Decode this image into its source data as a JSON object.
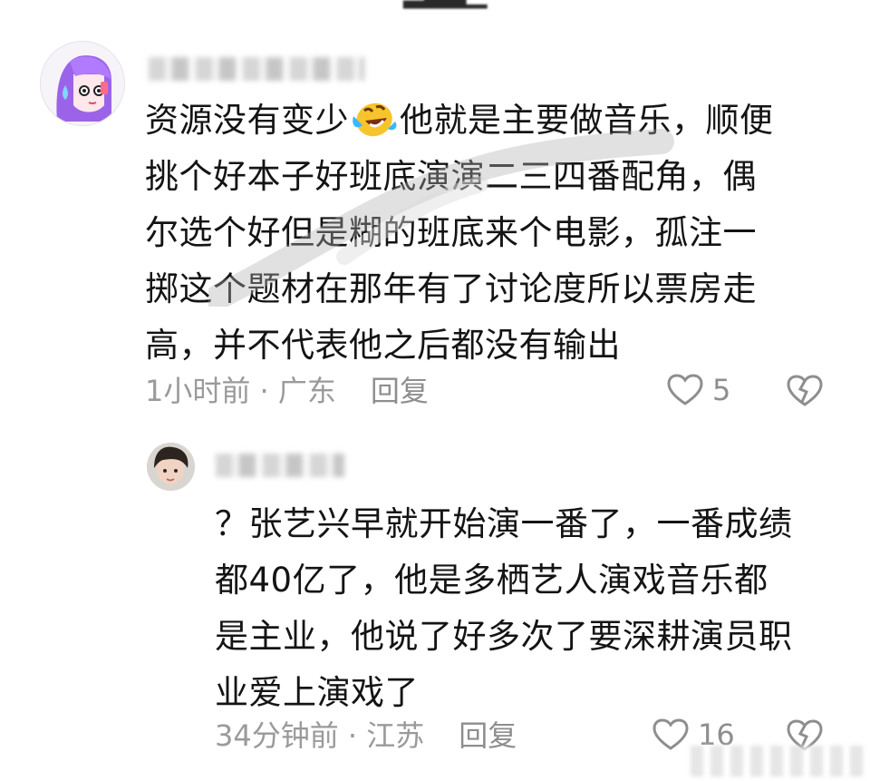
{
  "comments": [
    {
      "text_lines": [
        "资源没有变少",
        "挑个好本子好班底演演二三四番配角，偶",
        "尔选个好但是糊的班底来个电影，孤注一",
        "掷这个题材在那年有了讨论度所以票房走",
        "高，并不代表他之后都没有输出"
      ],
      "first_line_tail": "他就是主要做音乐，顺便",
      "emoji": "laughing-crying-emoji",
      "time_location": "1小时前 · 广东",
      "reply_label": "回复",
      "like_count": "5"
    },
    {
      "text_lines": [
        "？张艺兴早就开始演一番了，一番成绩",
        "都40亿了，他是多栖艺人演戏音乐都",
        "是主业，他说了好多次了要深耕演员职",
        "业爱上演戏了"
      ],
      "time_location": "34分钟前 · 江苏",
      "reply_label": "回复",
      "like_count": "16"
    }
  ],
  "icons": {
    "like": "heart-outline-icon",
    "dislike": "broken-heart-icon"
  },
  "colors": {
    "text": "#141414",
    "meta": "#9a9a9a",
    "avatar_purple": "#9b64e8",
    "emoji_yellow": "#f7c52b"
  }
}
